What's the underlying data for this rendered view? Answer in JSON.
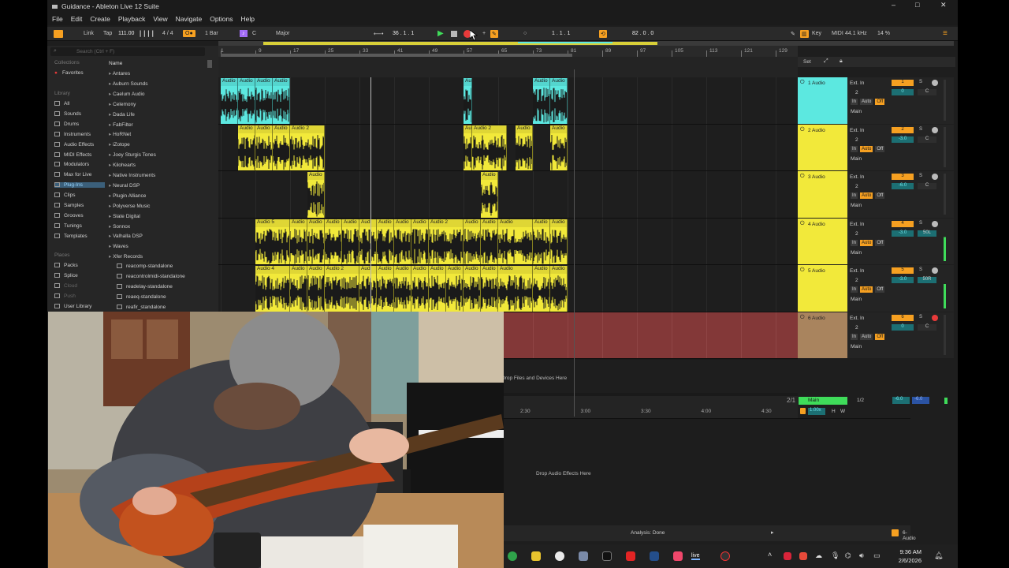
{
  "window": {
    "title": "Guidance - Ableton Live 12 Suite",
    "controls": [
      "–",
      "□",
      "✕"
    ]
  },
  "menu": [
    "File",
    "Edit",
    "Create",
    "Playback",
    "View",
    "Navigate",
    "Options",
    "Help"
  ],
  "transport": {
    "link": "Link",
    "tap": "Tap",
    "tempo": "111.00",
    "signature": "4 / 4",
    "quantize": "1 Bar",
    "key": "C",
    "scale": "Major",
    "arrangement_position": "36 .   1 .   1",
    "loop_start": "1 .   1 .   1",
    "loop_length": "82 .   0 .   0",
    "key_label": "Key",
    "midi_label": "MIDI",
    "sample_rate": "44.1 kHz",
    "cpu": "14 %"
  },
  "browser": {
    "search_placeholder": "Search (Ctrl + F)",
    "collections_label": "Collections",
    "favorites": "Favorites",
    "library_label": "Library",
    "library": [
      "All",
      "Sounds",
      "Drums",
      "Instruments",
      "Audio Effects",
      "MIDI Effects",
      "Modulators",
      "Max for Live",
      "Plug-Ins",
      "Clips",
      "Samples",
      "Grooves",
      "Tunings",
      "Templates"
    ],
    "places_label": "Places",
    "places": [
      "Packs",
      "Splice",
      "Cloud",
      "Push",
      "User Library"
    ],
    "name_header": "Name",
    "folders": [
      "Antares",
      "Auburn Sounds",
      "Caelum Audio",
      "Celemony",
      "Dada Life",
      "FabFilter",
      "HoRNet",
      "iZotope",
      "Joey Sturgis Tones",
      "Kilohearts",
      "Native Instruments",
      "Neural DSP",
      "Plugin Alliance",
      "Polyverse Music",
      "Slate Digital",
      "Sonnox",
      "Valhalla DSP",
      "Waves",
      "Xfer Records"
    ],
    "files": [
      "reacomp-standalone",
      "reacontrolmidi-standalone",
      "readelay-standalone",
      "reaeq-standalone",
      "reafir_standalone"
    ]
  },
  "ruler": {
    "bars": [
      "1",
      "9",
      "17",
      "25",
      "33",
      "41",
      "49",
      "57",
      "65",
      "73",
      "81",
      "89",
      "97",
      "105",
      "113",
      "121",
      "129"
    ],
    "times": [
      "2:30",
      "3:00",
      "3:30",
      "4:00",
      "4:30"
    ],
    "set_label": "Set"
  },
  "tracks": [
    {
      "name": "1 Audio",
      "color": "#5ce8e0",
      "number": "1",
      "input": "Ext. In",
      "channel": "2",
      "monitor": [
        "In",
        "Auto",
        "Off"
      ],
      "output": "Main",
      "volume": "0",
      "pan": "C",
      "clips": [
        {
          "label": "Audio",
          "start": 1,
          "end": 5
        },
        {
          "label": "Audio",
          "start": 5,
          "end": 9
        },
        {
          "label": "Audio",
          "start": 9,
          "end": 13
        },
        {
          "label": "Audio",
          "start": 13,
          "end": 17
        },
        {
          "label": "Au",
          "start": 57,
          "end": 59
        },
        {
          "label": "Audio",
          "start": 73,
          "end": 77
        },
        {
          "label": "Audio",
          "start": 77,
          "end": 81
        }
      ]
    },
    {
      "name": "2 Audio",
      "color": "#f2e93a",
      "number": "2",
      "input": "Ext. In",
      "channel": "2",
      "monitor": [
        "In",
        "Auto",
        "Off"
      ],
      "output": "Main",
      "volume": "-3.0",
      "pan": "C",
      "clips": [
        {
          "label": "Audio",
          "start": 5,
          "end": 9
        },
        {
          "label": "Audio",
          "start": 9,
          "end": 13
        },
        {
          "label": "Audio",
          "start": 13,
          "end": 17
        },
        {
          "label": "Audio 2",
          "start": 17,
          "end": 25
        },
        {
          "label": "Au",
          "start": 57,
          "end": 59
        },
        {
          "label": "Audio 2",
          "start": 59,
          "end": 67
        },
        {
          "label": "Audio",
          "start": 69,
          "end": 73
        },
        {
          "label": "Audio",
          "start": 77,
          "end": 81
        }
      ]
    },
    {
      "name": "3 Audio",
      "color": "#f2e93a",
      "number": "3",
      "input": "Ext. In",
      "channel": "2",
      "monitor": [
        "In",
        "Auto",
        "Off"
      ],
      "output": "Main",
      "volume": "-6.0",
      "pan": "C",
      "clips": [
        {
          "label": "Audio",
          "start": 21,
          "end": 25
        },
        {
          "label": "Audio",
          "start": 61,
          "end": 65
        }
      ]
    },
    {
      "name": "4 Audio",
      "color": "#f2e93a",
      "number": "4",
      "input": "Ext. In",
      "channel": "2",
      "monitor": [
        "In",
        "Auto",
        "Off"
      ],
      "output": "Main",
      "volume": "-3.0",
      "pan": "50L",
      "clips": [
        {
          "label": "Audio 5",
          "start": 9,
          "end": 17
        },
        {
          "label": "Audio",
          "start": 17,
          "end": 21
        },
        {
          "label": "Audio",
          "start": 21,
          "end": 25
        },
        {
          "label": "Audio",
          "start": 25,
          "end": 29
        },
        {
          "label": "Audio",
          "start": 29,
          "end": 33
        },
        {
          "label": "Audi",
          "start": 33,
          "end": 37
        },
        {
          "label": "Audio",
          "start": 37,
          "end": 41
        },
        {
          "label": "Audio",
          "start": 41,
          "end": 45
        },
        {
          "label": "Audio",
          "start": 45,
          "end": 49
        },
        {
          "label": "Audio 2",
          "start": 49,
          "end": 57
        },
        {
          "label": "Audio",
          "start": 57,
          "end": 61
        },
        {
          "label": "Audio",
          "start": 61,
          "end": 65
        },
        {
          "label": "Audio",
          "start": 65,
          "end": 73
        },
        {
          "label": "Audio",
          "start": 73,
          "end": 77
        },
        {
          "label": "Audio",
          "start": 77,
          "end": 81
        }
      ]
    },
    {
      "name": "5 Audio",
      "color": "#f2e93a",
      "number": "5",
      "input": "Ext. In",
      "channel": "2",
      "monitor": [
        "In",
        "Auto",
        "Off"
      ],
      "output": "Main",
      "volume": "-3.0",
      "pan": "50R",
      "clips": [
        {
          "label": "Audio 4",
          "start": 9,
          "end": 17
        },
        {
          "label": "Audio",
          "start": 17,
          "end": 21
        },
        {
          "label": "Audio",
          "start": 21,
          "end": 25
        },
        {
          "label": "Audio 2",
          "start": 25,
          "end": 33
        },
        {
          "label": "Audi",
          "start": 33,
          "end": 37
        },
        {
          "label": "Audio",
          "start": 37,
          "end": 41
        },
        {
          "label": "Audio",
          "start": 41,
          "end": 45
        },
        {
          "label": "Audio",
          "start": 45,
          "end": 49
        },
        {
          "label": "Audio",
          "start": 49,
          "end": 53
        },
        {
          "label": "Audio",
          "start": 53,
          "end": 57
        },
        {
          "label": "Audio",
          "start": 57,
          "end": 61
        },
        {
          "label": "Audio",
          "start": 61,
          "end": 65
        },
        {
          "label": "Audio",
          "start": 65,
          "end": 73
        },
        {
          "label": "Audio",
          "start": 73,
          "end": 77
        },
        {
          "label": "Audio",
          "start": 77,
          "end": 81
        }
      ]
    },
    {
      "name": "6 Audio",
      "color": "#a9845e",
      "number": "6",
      "input": "Ext. In",
      "channel": "2",
      "monitor": [
        "In",
        "Auto",
        "Off"
      ],
      "output": "Main",
      "volume": "0",
      "pan": "C",
      "clips": []
    }
  ],
  "drop_devices_text": "Drop Files and Devices Here",
  "master": {
    "page": "2/1",
    "name": "Main",
    "routing": "1/2",
    "volume": "-6.0",
    "volume2": "-6.0",
    "crossfade": "1.00x",
    "h": "H",
    "w": "W"
  },
  "detail": {
    "drop_effects_text": "Drop Audio Effects Here"
  },
  "status": {
    "analysis": "Analysis: Done",
    "selected_track": "6-Audio"
  },
  "clock": {
    "time": "9:36 AM",
    "date": "2/6/2026"
  }
}
